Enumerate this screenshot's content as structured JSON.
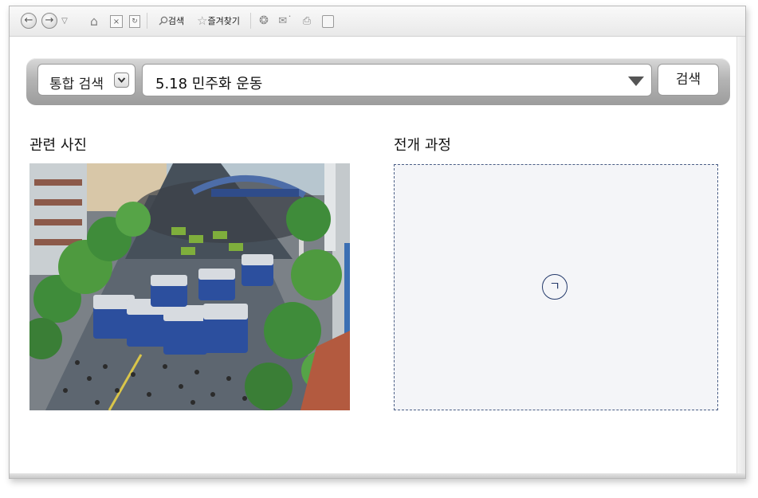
{
  "toolbar": {
    "search_label": "검색",
    "favorites_label": "즐겨찾기"
  },
  "search": {
    "scope_label": "통합 검색",
    "query": "5.18 민주화 운동",
    "button_label": "검색"
  },
  "sections": {
    "photos_title": "관련 사진",
    "process_title": "전개 과정",
    "process_marker": "ㄱ"
  },
  "colors": {
    "panel_border": "#4a5e85",
    "panel_fill": "#f4f5f8"
  }
}
